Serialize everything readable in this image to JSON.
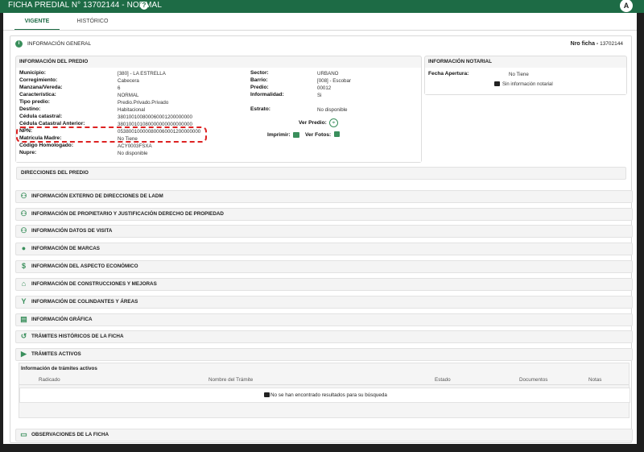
{
  "header": {
    "title": "FICHA PREDIAL N° 13702144 - NORMAL",
    "help_glyph": "?",
    "accessibility_glyph": "A"
  },
  "tabs": [
    {
      "label": "VIGENTE",
      "active": true
    },
    {
      "label": "HISTÓRICO",
      "active": false
    }
  ],
  "general": {
    "title": "INFORMACIÓN GENERAL",
    "nro_label": "Nro ficha -",
    "nro_value": "13702144"
  },
  "predio": {
    "title": "INFORMACIÓN DEL PREDIO",
    "left": [
      {
        "label": "Municipio:",
        "value": "[380] - LA ESTRELLA"
      },
      {
        "label": "Corregimiento:",
        "value": "Cabecera"
      },
      {
        "label": "Manzana/Vereda:",
        "value": "6"
      },
      {
        "label": "Característica:",
        "value": "NORMAL"
      },
      {
        "label": "Tipo predio:",
        "value": "Predio.Privado.Privado"
      },
      {
        "label": "Destino:",
        "value": "Habitacional"
      },
      {
        "label": "Cédula catastral:",
        "value": "380100100800060001200000000"
      },
      {
        "label": "Cédula Catastral Anterior:",
        "value": "380100101080000000000000000"
      },
      {
        "label": "NPN:",
        "value": "053800100000800060001200000000"
      },
      {
        "label": "Matrícula Madre:",
        "value": "No Tiene"
      },
      {
        "label": "Código Homologado:",
        "value": "ACY0003FSXA"
      },
      {
        "label": "Nupre:",
        "value": "No disponible"
      }
    ],
    "right": [
      {
        "label": "Sector:",
        "value": "URBANO"
      },
      {
        "label": "Barrio:",
        "value": "[008] - Escobar"
      },
      {
        "label": "Predio:",
        "value": "00012"
      },
      {
        "label": "Informalidad:",
        "value": "Si"
      }
    ],
    "estrato_label": "Estrato:",
    "estrato_value": "No disponible",
    "ver_predio": "Ver Predio:",
    "imprimir": "Imprimir:",
    "ver_fotos": "Ver Fotos:"
  },
  "notarial": {
    "title": "INFORMACIÓN NOTARIAL",
    "fecha_label": "Fecha Apertura:",
    "fecha_value": "No Tiene",
    "empty": "Sin información notarial"
  },
  "sections": [
    {
      "label": "DIRECCIONES DEL PREDIO",
      "icon": "none"
    },
    {
      "label": "INFORMACIÓN EXTERNO DE DIRECCIONES DE LADM",
      "icon": "people-icon"
    },
    {
      "label": "INFORMACIÓN DE PROPIETARIO Y JUSTIFICACIÓN DERECHO DE PROPIEDAD",
      "icon": "people-icon"
    },
    {
      "label": "INFORMACIÓN DATOS DE VISITA",
      "icon": "people-icon"
    },
    {
      "label": "INFORMACIÓN DE MARCAS",
      "icon": "circle-icon"
    },
    {
      "label": "INFORMACIÓN DEL ASPECTO ECONÓMICO",
      "icon": "dollar-icon"
    },
    {
      "label": "INFORMACIÓN DE CONSTRUCCIONES Y MEJORAS",
      "icon": "home-icon"
    },
    {
      "label": "INFORMACIÓN DE COLINDANTES Y ÁREAS",
      "icon": "fork-icon"
    },
    {
      "label": "INFORMACIÓN GRÁFICA",
      "icon": "map-icon"
    },
    {
      "label": "TRÁMITES HISTÓRICOS DE LA FICHA",
      "icon": "history-icon"
    },
    {
      "label": "TRÁMITES ACTIVOS",
      "icon": "triangle-right-icon"
    },
    {
      "label": "OBSERVACIONES DE LA FICHA",
      "icon": "comment-icon"
    }
  ],
  "tramites_table": {
    "title": "Información de trámites activos",
    "columns": [
      "Radicado",
      "Nombre del Trámite",
      "Estado",
      "Documentos",
      "Notas"
    ],
    "empty": "No se han encontrado resultados para su búsqueda"
  }
}
